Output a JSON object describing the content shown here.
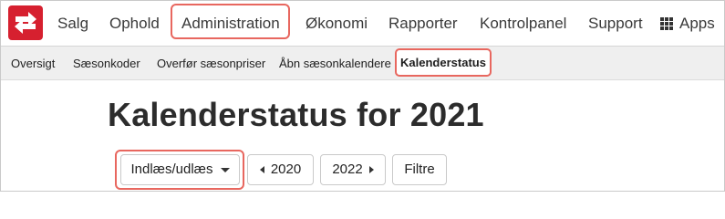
{
  "nav": {
    "logo_icon": "swap-arrows-logo",
    "items": [
      {
        "label": "Salg"
      },
      {
        "label": "Ophold"
      },
      {
        "label": "Administration",
        "highlighted": true
      },
      {
        "label": "Økonomi"
      },
      {
        "label": "Rapporter"
      },
      {
        "label": "Kontrolpanel"
      },
      {
        "label": "Support"
      }
    ],
    "apps": {
      "label": "Apps",
      "icon": "grid-icon"
    }
  },
  "subnav": {
    "items": [
      {
        "label": "Oversigt"
      },
      {
        "label": "Sæsonkoder"
      },
      {
        "label": "Overfør sæsonpriser"
      },
      {
        "label": "Åbn sæsonkalendere"
      },
      {
        "label": "Kalenderstatus",
        "active": true
      }
    ]
  },
  "page": {
    "title": "Kalenderstatus for 2021"
  },
  "toolbar": {
    "import_export": "Indlæs/udlæs",
    "prev_year": "2020",
    "next_year": "2022",
    "filter": "Filtre"
  },
  "colors": {
    "brand": "#d6202f",
    "highlight": "#e8675f",
    "subnav_bg": "#efefef"
  }
}
